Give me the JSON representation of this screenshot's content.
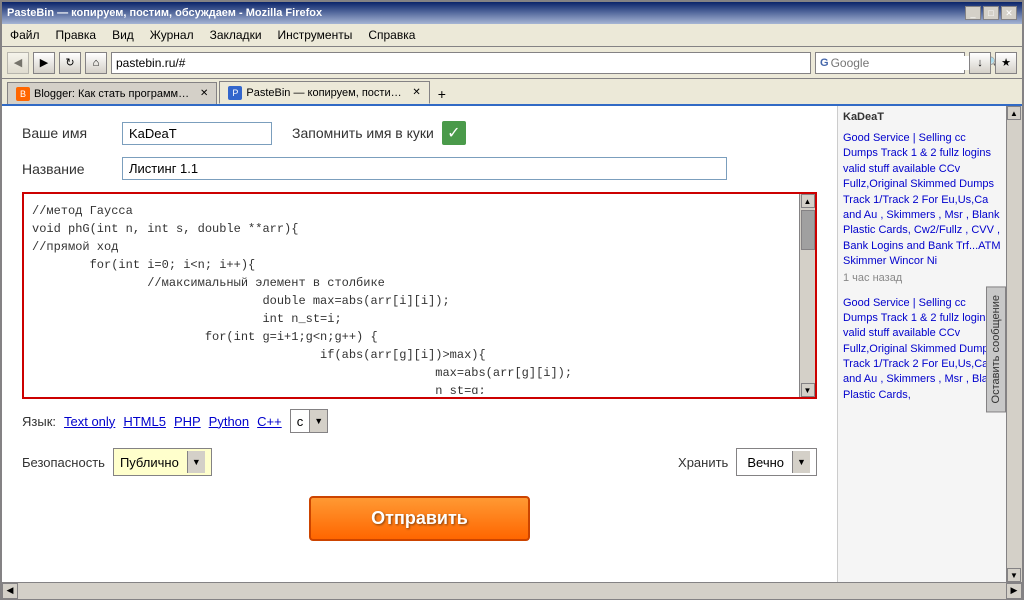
{
  "browser": {
    "title": "PasteBin — копируем, постим, обсуждаем - Mozilla Firefox",
    "menu_items": [
      "Файл",
      "Правка",
      "Вид",
      "Журнал",
      "Закладки",
      "Инструменты",
      "Справка"
    ],
    "address": "pastebin.ru/#",
    "search_placeholder": "Google",
    "tabs": [
      {
        "label": "Blogger: Как стать программистом — Но...",
        "active": false,
        "favicon": "B"
      },
      {
        "label": "PasteBin — копируем, постим, обсужда...",
        "active": true,
        "favicon": "P"
      }
    ],
    "new_tab_icon": "+"
  },
  "toolbar_icons": {
    "back": "◀",
    "forward": "▶",
    "refresh": "↻",
    "home": "⌂",
    "download": "↓"
  },
  "form": {
    "name_label": "Ваше имя",
    "name_value": "KaDeaT",
    "remember_label": "Запомнить имя в куки",
    "title_label": "Название",
    "title_value": "Листинг 1.1",
    "code_content": "//метод Гаусса\nvoid phG(int n, int s, double **arr){\n//прямой ход\n\tfor(int i=0; i<n; i++){\n\t\t//максимальный элемент в столбике\n\t\t\t\tdouble max=abs(arr[i][i]);\n\t\t\t\tint n_st=i;\n\t\t\tfor(int g=i+1;g<n;g++) {\n\t\t\t\t\tif(abs(arr[g][i])>max){\n\t\t\t\t\t\t\tmax=abs(arr[g][i]);\n\t\t\t\t\t\t\tn_st=g;\n\t\t\t\t\t}",
    "lang_label": "Язык:",
    "lang_options": [
      "Text only",
      "HTML5",
      "PHP",
      "Python",
      "C++"
    ],
    "lang_selected": "с",
    "security_label": "Безопасность",
    "security_value": "Публично",
    "storage_label": "Хранить",
    "storage_value": "Вечно",
    "submit_label": "Отправить"
  },
  "sidebar": {
    "username": "KaDeaT",
    "tab_label": "Оставить сообщение",
    "posts": [
      {
        "link_text": "Good Service | Selling cc Dumps Track 1 & 2 fullz logins valid stuff available CCv Fullz,Original Skimmed Dumps Track 1/Track 2 For Eu,Us,Ca and Au , Skimmers , Msr , Blank Plastic Cards, Cw2/Fullz , CVV , Bank Logins and Bank Trf...ATM Skimmer Wincor Ni",
        "time": "1 час назад"
      },
      {
        "link_text": "Good Service | Selling cc Dumps Track 1 & 2 fullz logins valid stuff available CCv Fullz,Original Skimmed Dumps Track 1/Track 2 For Eu,Us,Ca and Au , Skimmers , Msr , Blank Plastic Cards,",
        "time": ""
      }
    ]
  }
}
